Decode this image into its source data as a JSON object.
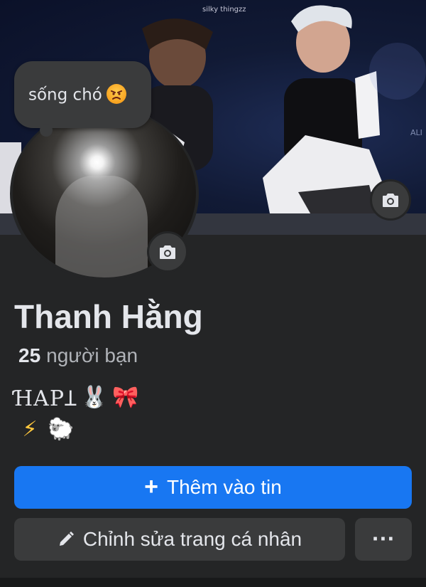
{
  "cover": {
    "watermark": "silky thingzz",
    "side_text": "ALI"
  },
  "note": {
    "text": "sống chó",
    "emoji": "angry-face"
  },
  "profile": {
    "name": "Thanh Hằng",
    "friends_count": "25",
    "friends_label": "người bạn",
    "bio_line1_text": "ꞪAPꞱ",
    "bio_line1_emojis": [
      "🐰",
      "🎀"
    ],
    "bio_line2_emojis": [
      "⚡",
      "🐑"
    ]
  },
  "buttons": {
    "add_story_icon": "+",
    "add_story_label": "Thêm vào tin",
    "edit_profile_label": "Chỉnh sửa trang cá nhân",
    "more_label": "···"
  },
  "colors": {
    "background": "#242526",
    "primary_button": "#1877f2",
    "secondary_button": "#3a3b3c",
    "text": "#e4e6eb",
    "muted_text": "#b0b3b8"
  }
}
